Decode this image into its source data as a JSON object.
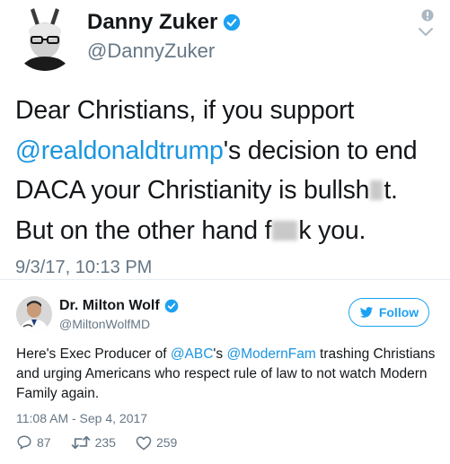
{
  "tweet1": {
    "display_name": "Danny Zuker",
    "handle": "@DannyZuker",
    "verified_icon": "verified-badge-icon",
    "text": {
      "p1": "Dear Christians, if you support ",
      "mention": "@realdonaldtrump",
      "p2": "'s decision to end DACA your Christianity is bullsh",
      "p3": "t.  But on the other hand f",
      "p4": "k you."
    },
    "timestamp": "9/3/17, 10:13 PM"
  },
  "tweet2": {
    "display_name": "Dr. Milton Wolf",
    "handle": "@MiltonWolfMD",
    "follow_label": "Follow",
    "text": {
      "p1": "Here's Exec Producer of ",
      "m1": "@ABC",
      "p2": "'s ",
      "m2": "@ModernFam",
      "p3": " trashing Christians and urging Americans who respect rule of law to not watch Modern Family again."
    },
    "timestamp": "11:08 AM - Sep 4, 2017",
    "actions": {
      "replies": "87",
      "retweets": "235",
      "likes": "259"
    }
  },
  "colors": {
    "accent": "#1da1f2",
    "mention": "#1b95e0",
    "muted": "#657786",
    "text": "#14171a"
  }
}
